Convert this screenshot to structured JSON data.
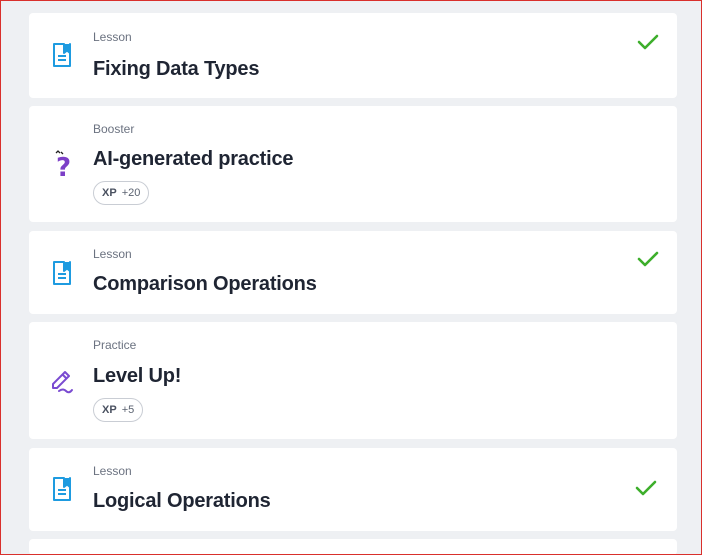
{
  "cards": [
    {
      "type": "Lesson",
      "title": "Fixing Data Types",
      "completed": true,
      "icon": "lesson-icon"
    },
    {
      "type": "Booster",
      "title": "AI-generated practice",
      "xp_label": "XP",
      "xp_value": "+20",
      "icon": "question-mark-icon"
    },
    {
      "type": "Lesson",
      "title": "Comparison Operations",
      "completed": true,
      "icon": "lesson-icon"
    },
    {
      "type": "Practice",
      "title": "Level Up!",
      "xp_label": "XP",
      "xp_value": "+5",
      "icon": "pencil-icon"
    },
    {
      "type": "Lesson",
      "title": "Logical Operations",
      "completed": true,
      "icon": "lesson-icon"
    }
  ],
  "colors": {
    "lesson_icon": "#1e9be0",
    "booster_icon": "#7c3fc7",
    "practice_icon": "#7a4bd1",
    "check": "#3dae2b"
  }
}
